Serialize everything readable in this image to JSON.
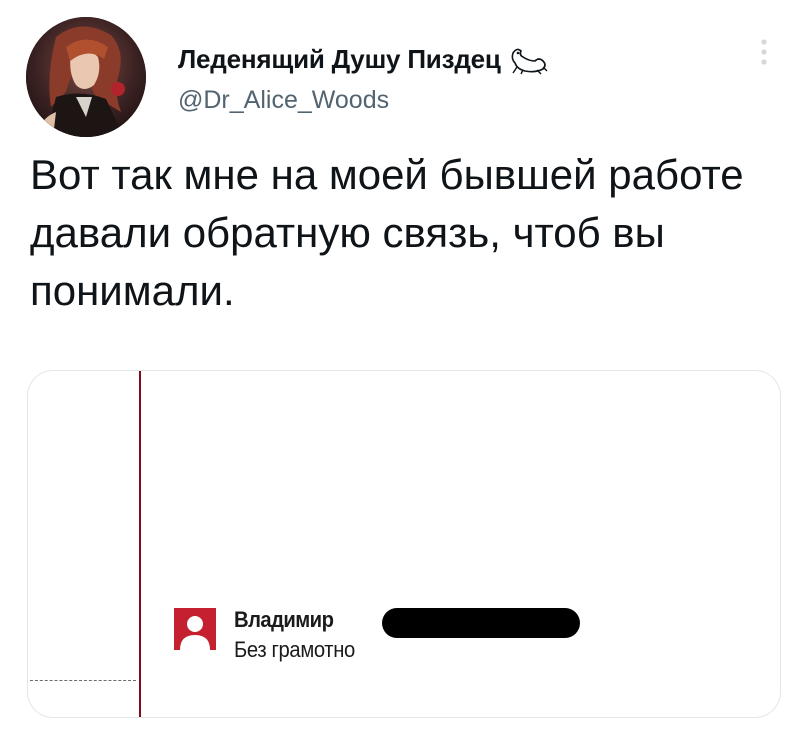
{
  "tweet": {
    "author": {
      "display_name": "Леденящий Душу Пиздец",
      "emoji": "frog-icon",
      "handle": "@Dr_Alice_Woods",
      "avatar": "anime-portrait-avatar"
    },
    "text": "Вот так мне на моей бывшей работе давали обратную связь, чтоб вы понимали.",
    "more_icon": "more-options-icon"
  },
  "media": {
    "comment": {
      "author": "Владимир",
      "author_redacted": true,
      "text": "Без грамотно",
      "avatar_icon": "default-user-icon"
    },
    "colors": {
      "accent_line": "#7a0f1c",
      "comment_avatar": "#c4202f"
    }
  },
  "colors": {
    "text": "#0f1419",
    "secondary": "#536471",
    "border": "#e3e6e8"
  }
}
